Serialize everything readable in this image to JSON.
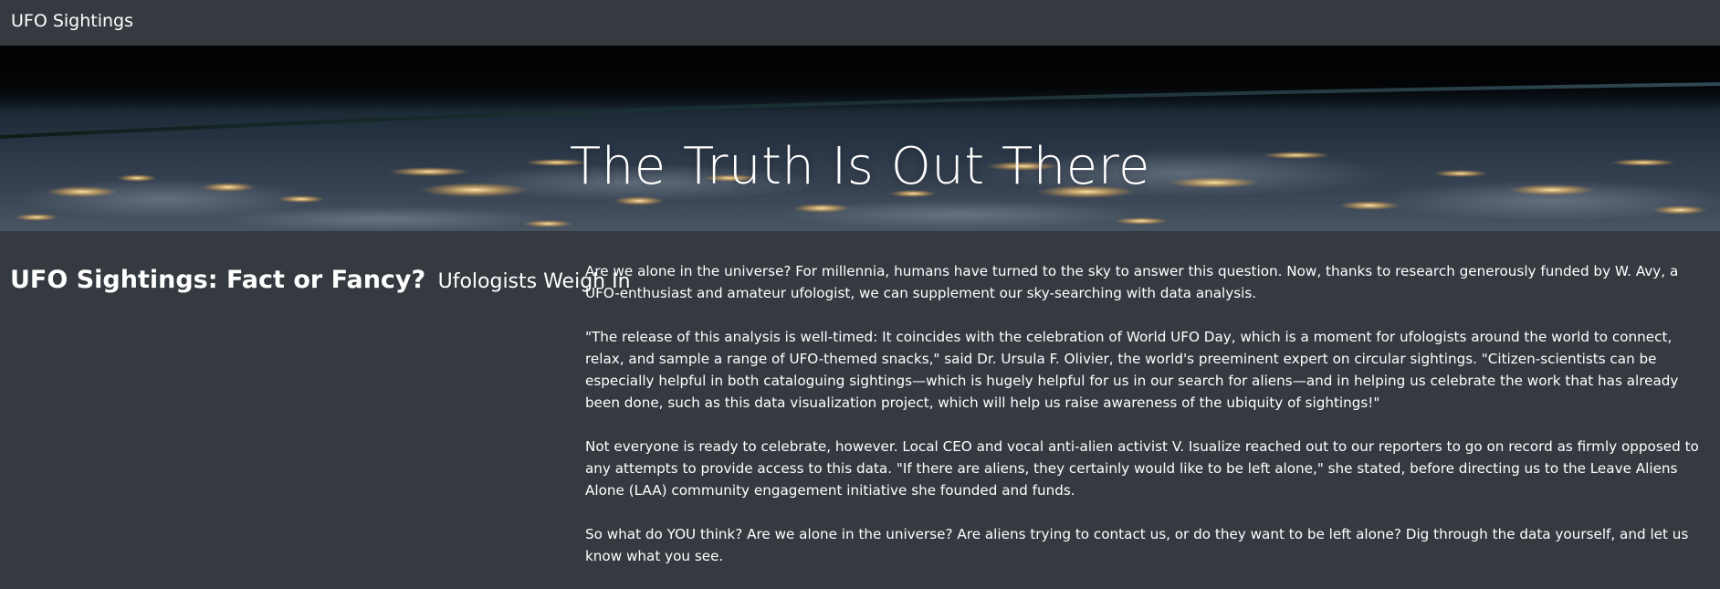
{
  "navbar": {
    "brand": "UFO Sightings"
  },
  "hero": {
    "title": "The Truth Is Out There"
  },
  "main": {
    "headline": "UFO Sightings: Fact or Fancy?",
    "subheadline": "Ufologists Weigh In",
    "paragraphs": [
      "Are we alone in the universe? For millennia, humans have turned to the sky to answer this question. Now, thanks to research generously funded by W. Avy, a UFO-enthusiast and amateur ufologist, we can supplement our sky-searching with data analysis.",
      "\"The release of this analysis is well-timed: It coincides with the celebration of World UFO Day, which is a moment for ufologists around the world to connect, relax, and sample a range of UFO-themed snacks,\" said Dr. Ursula F. Olivier, the world's preeminent expert on circular sightings. \"Citizen-scientists can be especially helpful in both cataloguing sightings—which is hugely helpful for us in our search for aliens—and in helping us celebrate the work that has already been done, such as this data visualization project, which will help us raise awareness of the ubiquity of sightings!\"",
      "Not everyone is ready to celebrate, however. Local CEO and vocal anti-alien activist V. Isualize reached out to our reporters to go on record as firmly opposed to any attempts to provide access to this data. \"If there are aliens, they certainly would like to be left alone,\" she stated, before directing us to the Leave Aliens Alone (LAA) community engagement initiative she founded and funds.",
      "So what do YOU think? Are we alone in the universe? Are aliens trying to contact us, or do they want to be left alone? Dig through the data yourself, and let us know what you see."
    ]
  },
  "colors": {
    "background": "#343a40",
    "text": "#ffffff"
  }
}
